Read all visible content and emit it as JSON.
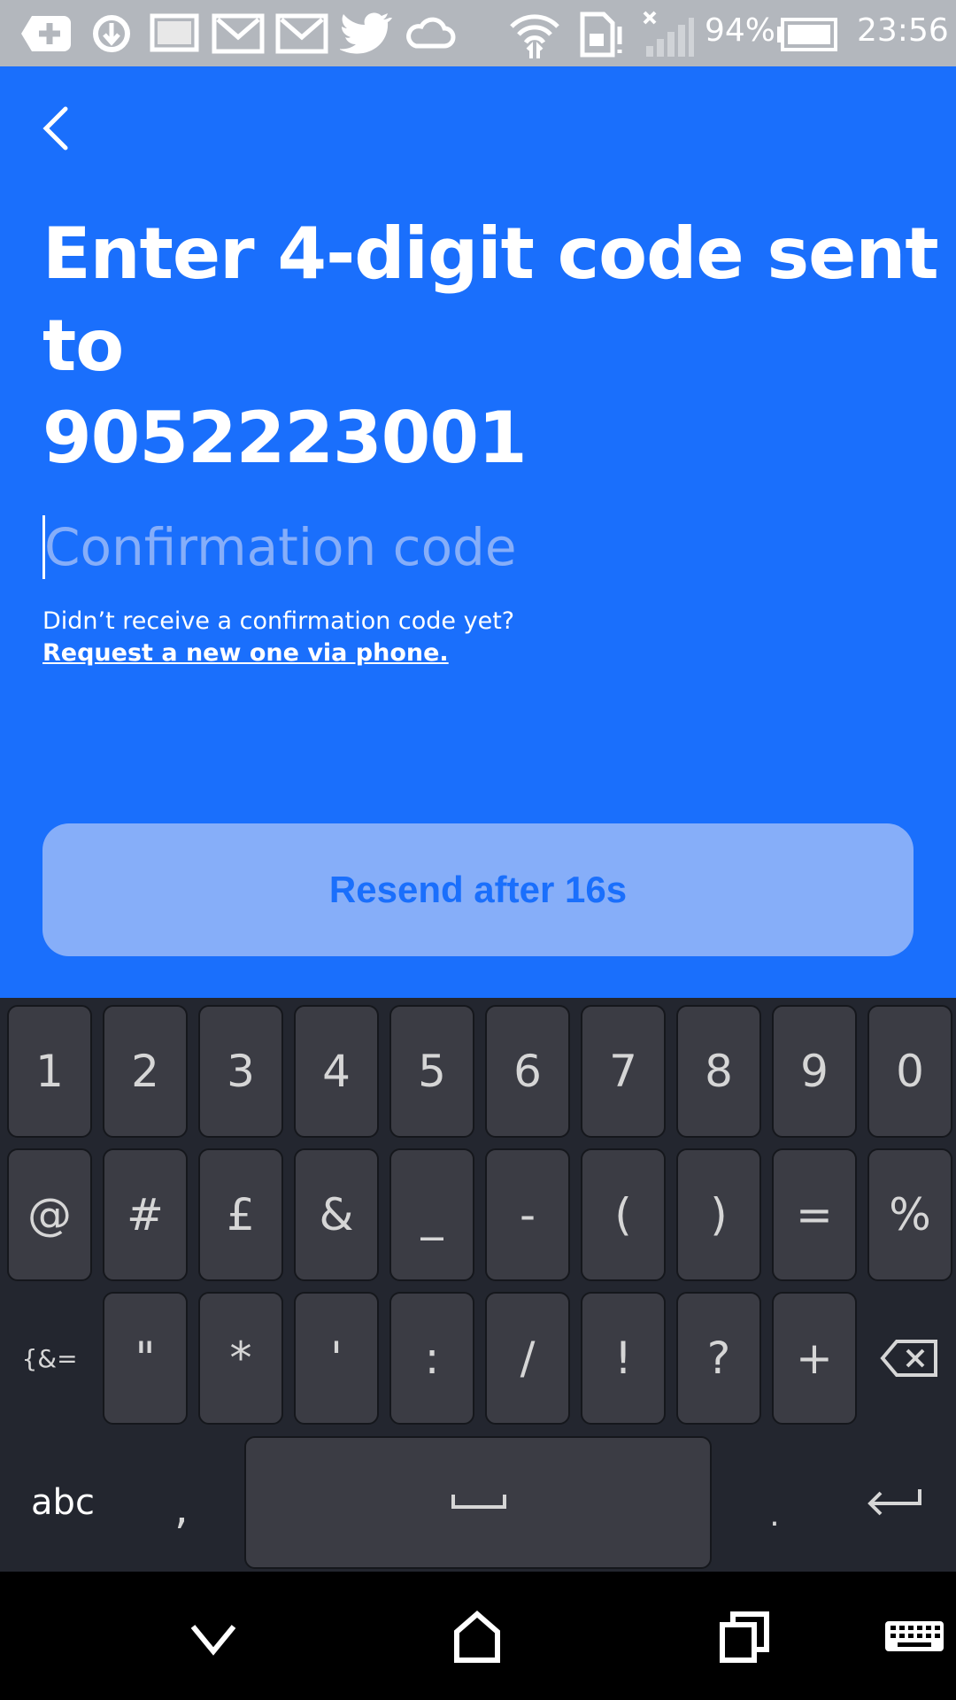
{
  "status_bar": {
    "battery_percent": "94%",
    "time": "23:56",
    "icons": [
      "add-icon",
      "sync-icon",
      "image-icon",
      "gmail-icon",
      "gmail-icon",
      "twitter-icon",
      "cloud-icon",
      "wifi-icon",
      "sim-alert-icon",
      "signal-icon",
      "battery-icon"
    ]
  },
  "screen": {
    "title_line1": "Enter 4-digit code sent",
    "title_line2": "to",
    "title_line3": "9052223001",
    "code_placeholder": "Confirmation code",
    "hint_text": "Didn’t receive a confirmation code yet?",
    "link_text": "Request a new one via phone.",
    "resend_label": "Resend after 16s"
  },
  "keyboard": {
    "row1": [
      "1",
      "2",
      "3",
      "4",
      "5",
      "6",
      "7",
      "8",
      "9",
      "0"
    ],
    "row2": [
      "@",
      "#",
      "£",
      "&",
      "_",
      "-",
      "(",
      ")",
      "=",
      "%"
    ],
    "row3": [
      "{&=",
      "\"",
      "*",
      "'",
      ":",
      "/",
      "!",
      "?",
      "+"
    ],
    "row4_left": "abc",
    "row4_comma": ",",
    "row4_period": "."
  },
  "colors": {
    "accent": "#1a6ffc",
    "button_bg": "#86aef9",
    "keyboard_bg": "#23262f",
    "key_bg": "#3b3c44"
  }
}
